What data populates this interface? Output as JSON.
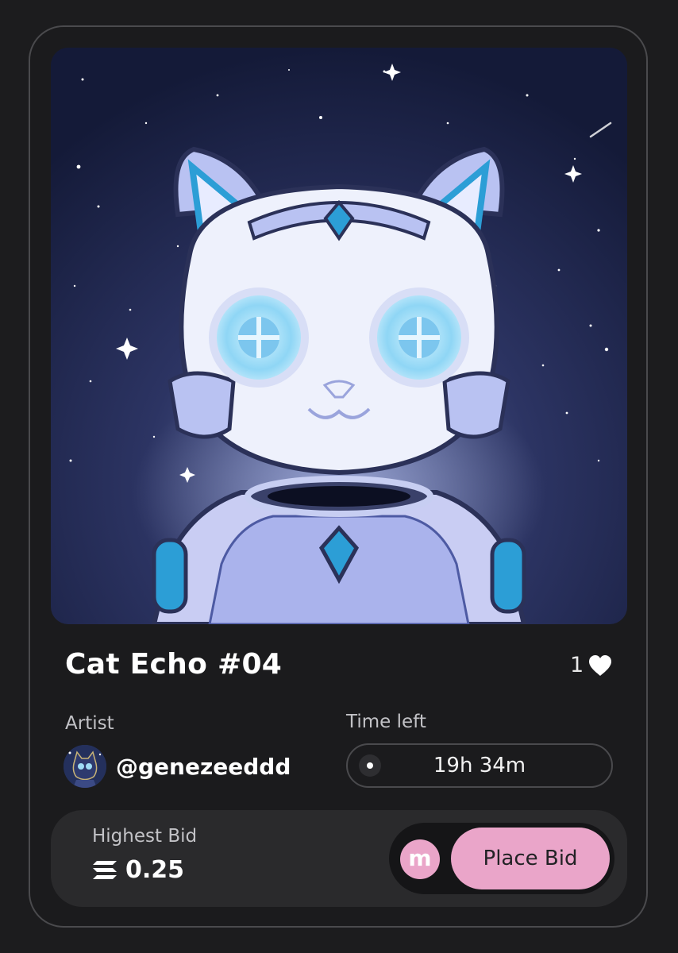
{
  "nft": {
    "title": "Cat Echo #04",
    "likes": "1",
    "like_icon": "heart-icon"
  },
  "artist": {
    "label": "Artist",
    "handle": "@genezeeddd"
  },
  "auction": {
    "time_label": "Time left",
    "time_value": "19h 34m"
  },
  "bid": {
    "label": "Highest Bid",
    "value": "0.25",
    "currency_icon": "solana-icon",
    "badge_letter": "m",
    "place_bid_label": "Place Bid"
  },
  "colors": {
    "background": "#1c1c1e",
    "accent_pink": "#eaa5c9",
    "card_border": "#4a4a4d"
  }
}
